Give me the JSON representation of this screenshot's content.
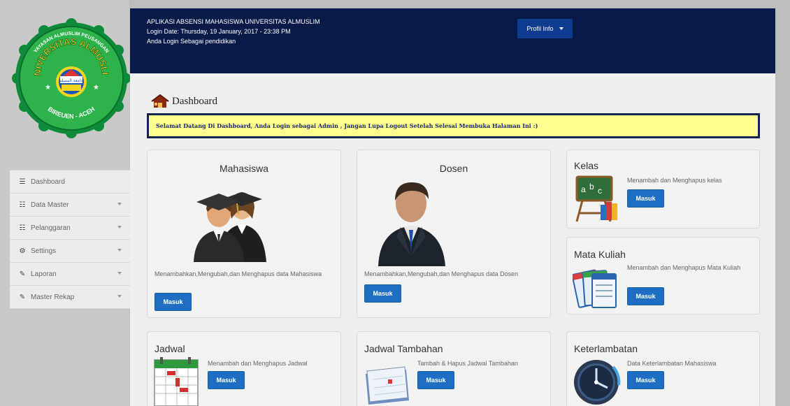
{
  "logo": {
    "top_text": "YAYASAN ALMUSLIM PEUSANGAN",
    "main_text": "UNIVERSITAS ALMUSLIM",
    "bottom_text": "BIREUEN - ACEH",
    "arabic_text": "جامعة المسلم",
    "colors": {
      "outer": "#0e8a3a",
      "inner": "#2db34a",
      "text": "#ffffff",
      "yellow": "#f7d51d"
    }
  },
  "sidebar": {
    "items": [
      {
        "label": "Dashboard",
        "icon": "list-icon",
        "glyph": "☰",
        "active": true,
        "has_caret": false
      },
      {
        "label": "Data Master",
        "icon": "table-icon",
        "glyph": "☷",
        "active": false,
        "has_caret": true
      },
      {
        "label": "Pelanggaran",
        "icon": "table-icon",
        "glyph": "☷",
        "active": false,
        "has_caret": true
      },
      {
        "label": "Settings",
        "icon": "settings-sliders-icon",
        "glyph": "⚙",
        "active": false,
        "has_caret": true
      },
      {
        "label": "Laporan",
        "icon": "pencil-icon",
        "glyph": "✎",
        "active": false,
        "has_caret": true
      },
      {
        "label": "Master Rekap",
        "icon": "pencil-icon",
        "glyph": "✎",
        "active": false,
        "has_caret": true
      }
    ]
  },
  "header": {
    "app_title": "APLIKASI ABSENSI MAHASISWA UNIVERSITAS ALMUSLIM",
    "login_date": "Login Date: Thursday, 19 January, 2017 - 23:38 PM",
    "login_as": "Anda Login Sebagai pendidikan",
    "profile_button": "Profil Info"
  },
  "dashboard": {
    "title": "Dashboard",
    "welcome": "Selamat Datang Di Dashboard, Anda Login sebagai Admin , Jangan Lupa Logout Setelah Selesai Membuka Halaman Ini :)"
  },
  "cards": {
    "mahasiswa": {
      "title": "Mahasiswa",
      "desc": "Menambahkan,Mengubah,dan Menghapus data Mahasiswa",
      "button": "Masuk"
    },
    "dosen": {
      "title": "Dosen",
      "desc": "Menambahkan,Mengubah,dan Menghapus data Dosen",
      "button": "Masuk"
    },
    "kelas": {
      "title": "Kelas",
      "desc": "Menambah dan Menghapus kelas",
      "button": "Masuk"
    },
    "mata_kuliah": {
      "title": "Mata Kuliah",
      "desc": "Menambah dan Menghapus Mata Kuliah",
      "button": "Masuk"
    },
    "jadwal": {
      "title": "Jadwal",
      "desc": "Menambah dan Menghapus Jadwal",
      "button": "Masuk"
    },
    "jadwal_tambahan": {
      "title": "Jadwal Tambahan",
      "desc": "Tambah & Hapus Jadwal Tambahan",
      "button": "Masuk"
    },
    "keterlambatan": {
      "title": "Keterlambatan",
      "desc": "Data Keterlambatan Mahasiswa",
      "button": "Masuk"
    }
  },
  "colors": {
    "header_bg": "#081a47",
    "button_blue": "#1e6fc4",
    "welcome_bg": "#ffff8f",
    "welcome_border": "#10224d"
  }
}
